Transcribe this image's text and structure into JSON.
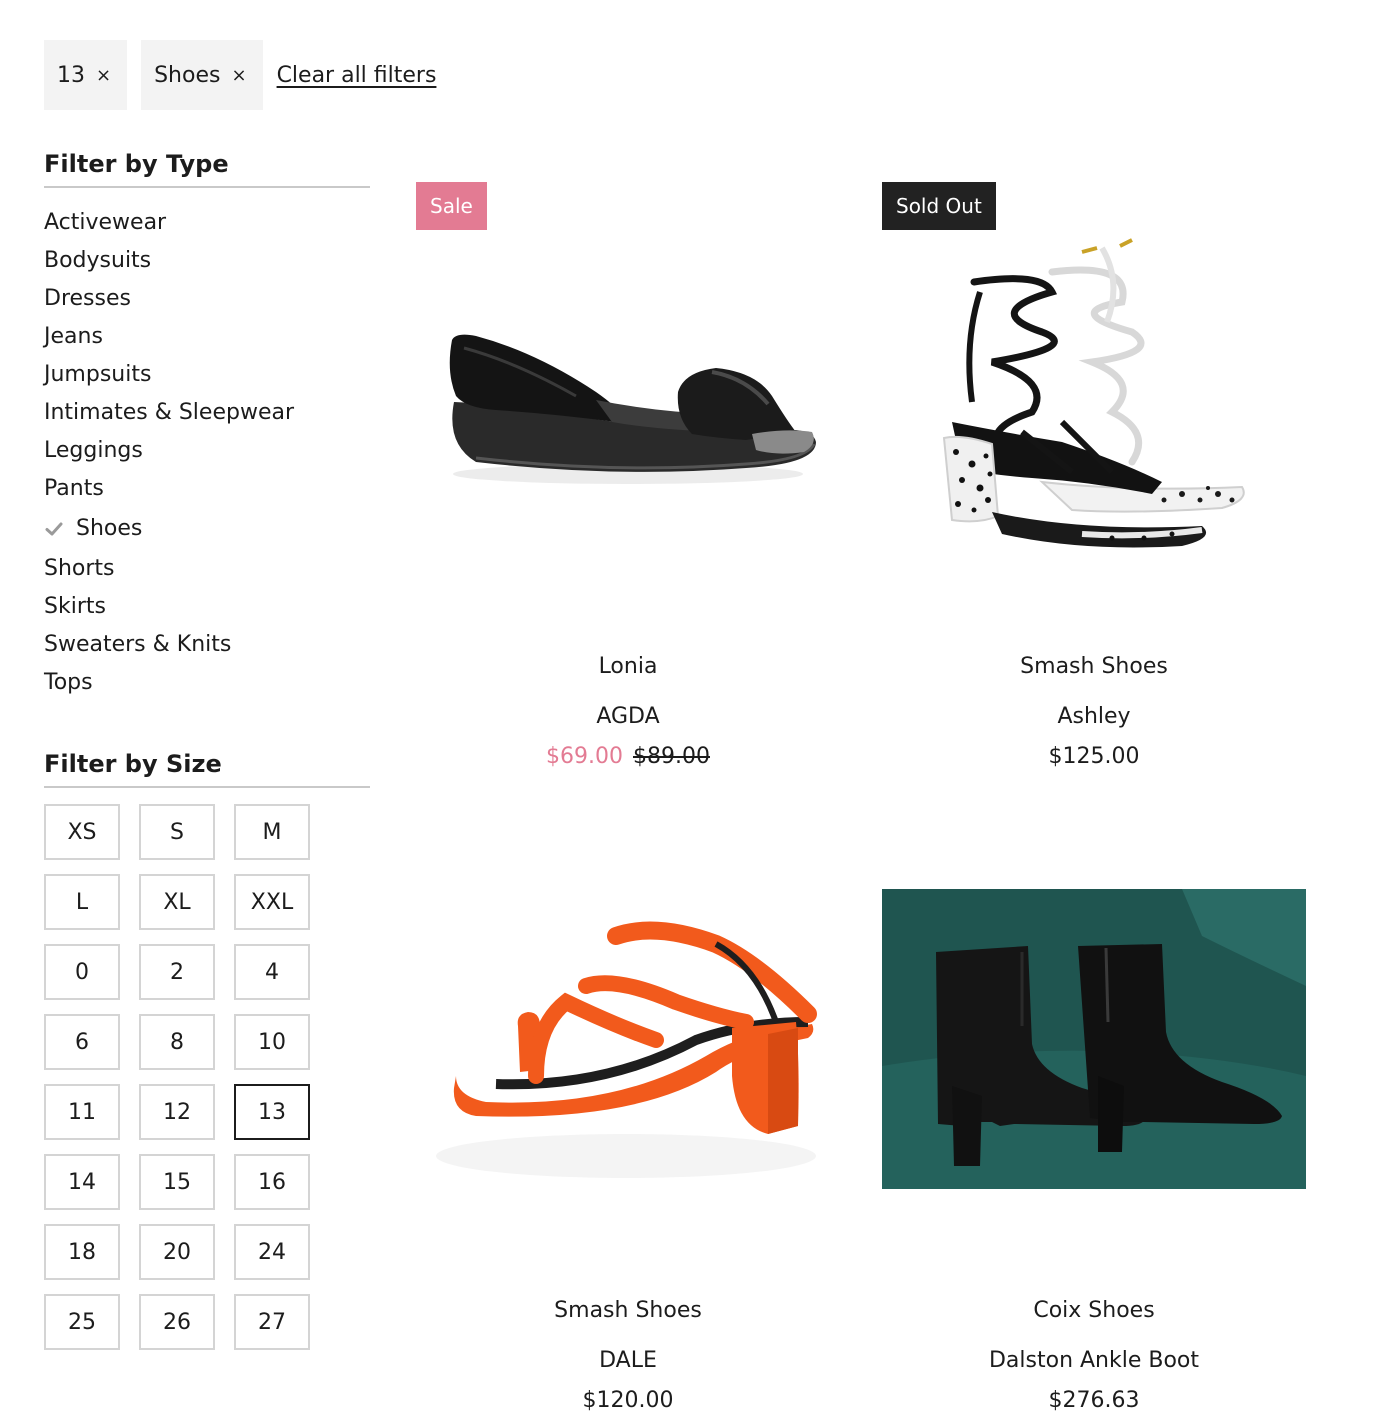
{
  "active_filters": [
    {
      "label": "13",
      "remove": "×"
    },
    {
      "label": "Shoes",
      "remove": "×"
    }
  ],
  "clear_all_label": "Clear all filters",
  "filter_type": {
    "title": "Filter by Type",
    "items": [
      {
        "label": "Activewear",
        "selected": false
      },
      {
        "label": "Bodysuits",
        "selected": false
      },
      {
        "label": "Dresses",
        "selected": false
      },
      {
        "label": "Jeans",
        "selected": false
      },
      {
        "label": "Jumpsuits",
        "selected": false
      },
      {
        "label": "Intimates & Sleepwear",
        "selected": false
      },
      {
        "label": "Leggings",
        "selected": false
      },
      {
        "label": "Pants",
        "selected": false
      },
      {
        "label": "Shoes",
        "selected": true
      },
      {
        "label": "Shorts",
        "selected": false
      },
      {
        "label": "Skirts",
        "selected": false
      },
      {
        "label": "Sweaters & Knits",
        "selected": false
      },
      {
        "label": "Tops",
        "selected": false
      }
    ]
  },
  "filter_size": {
    "title": "Filter by Size",
    "sizes": [
      "XS",
      "S",
      "M",
      "L",
      "XL",
      "XXL",
      "0",
      "2",
      "4",
      "6",
      "8",
      "10",
      "11",
      "12",
      "13",
      "14",
      "15",
      "16",
      "18",
      "20",
      "24",
      "25",
      "26",
      "27"
    ],
    "selected": "13"
  },
  "products": [
    {
      "vendor": "Lonia",
      "name": "AGDA",
      "price": "$69.00",
      "compare_price": "$89.00",
      "on_sale": true,
      "badge": "Sale",
      "image": "black-flat-sandal"
    },
    {
      "vendor": "Smash Shoes",
      "name": "Ashley",
      "price": "$125.00",
      "compare_price": "",
      "on_sale": false,
      "badge": "Sold Out",
      "image": "lace-up-heels"
    },
    {
      "vendor": "Smash Shoes",
      "name": "DALE",
      "price": "$120.00",
      "compare_price": "",
      "on_sale": false,
      "badge": "",
      "image": "orange-strap-heel"
    },
    {
      "vendor": "Coix Shoes",
      "name": "Dalston Ankle Boot",
      "price": "$276.63",
      "compare_price": "",
      "on_sale": false,
      "badge": "",
      "image": "black-ankle-boots"
    }
  ],
  "colors": {
    "sale_pink": "#e37b93",
    "sold_out_bg": "#222222",
    "chip_bg": "#f3f3f3",
    "boot_bg": "#1f5550"
  },
  "icons": {
    "check": "check-icon",
    "remove": "close-icon"
  }
}
